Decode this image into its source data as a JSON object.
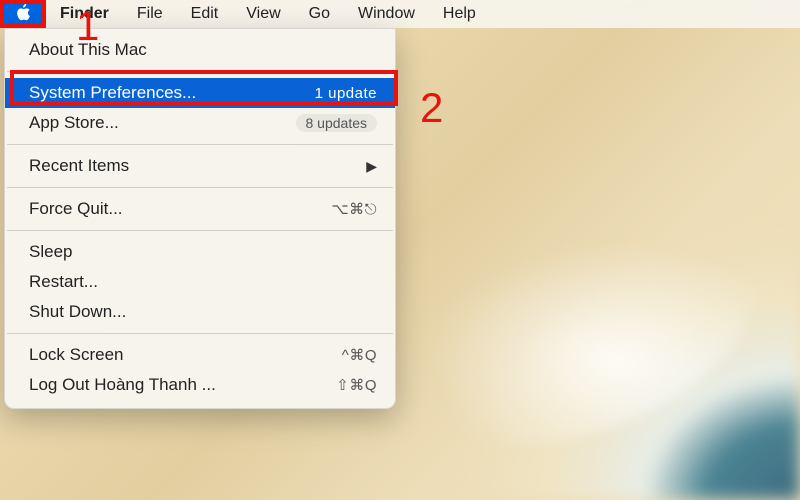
{
  "menubar": {
    "app": "Finder",
    "items": [
      "File",
      "Edit",
      "View",
      "Go",
      "Window",
      "Help"
    ]
  },
  "apple_menu": {
    "about": "About This Mac",
    "system_prefs": {
      "label": "System Preferences...",
      "badge": "1 update"
    },
    "app_store": {
      "label": "App Store...",
      "badge": "8 updates"
    },
    "recent_items": "Recent Items",
    "force_quit": {
      "label": "Force Quit...",
      "shortcut": "⌥⌘⎋"
    },
    "sleep": "Sleep",
    "restart": "Restart...",
    "shut_down": "Shut Down...",
    "lock_screen": {
      "label": "Lock Screen",
      "shortcut": "^⌘Q"
    },
    "log_out": {
      "label": "Log Out Hoàng Thanh ...",
      "shortcut": "⇧⌘Q"
    }
  },
  "annotations": {
    "step1": "1",
    "step2": "2"
  }
}
